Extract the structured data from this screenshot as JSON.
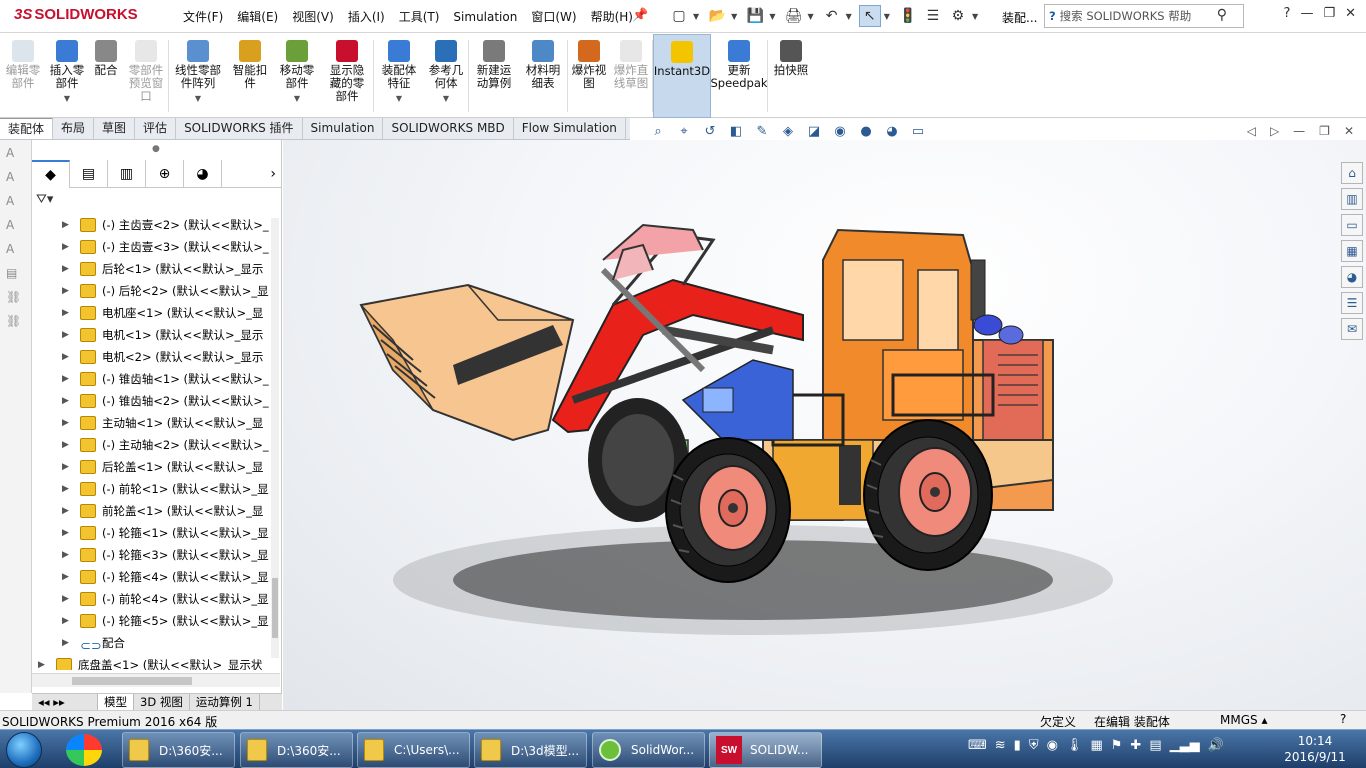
{
  "app": {
    "brand": "SOLIDWORKS",
    "menu": [
      "文件(F)",
      "编辑(E)",
      "视图(V)",
      "插入(I)",
      "工具(T)",
      "Simulation",
      "窗口(W)",
      "帮助(H)"
    ],
    "doc_label": "装配...",
    "search_placeholder": "搜索 SOLIDWORKS 帮助"
  },
  "ribbon": {
    "buttons": [
      {
        "label": "编辑零\n部件",
        "disabled": true
      },
      {
        "label": "插入零\n部件",
        "disabled": false
      },
      {
        "label": "配合",
        "disabled": false
      },
      {
        "label": "零部件\n预览窗\n口",
        "disabled": true
      },
      {
        "label": "线性零部\n件阵列",
        "disabled": false
      },
      {
        "label": "智能扣\n件",
        "disabled": false
      },
      {
        "label": "移动零\n部件",
        "disabled": false
      },
      {
        "label": "显示隐\n藏的零\n部件",
        "disabled": false
      },
      {
        "label": "装配体\n特征",
        "disabled": false
      },
      {
        "label": "参考几\n何体",
        "disabled": false
      },
      {
        "label": "新建运\n动算例",
        "disabled": false
      },
      {
        "label": "材料明\n细表",
        "disabled": false
      },
      {
        "label": "爆炸视\n图",
        "disabled": false
      },
      {
        "label": "爆炸直\n线草图",
        "disabled": true
      },
      {
        "label": "Instant3D",
        "disabled": false,
        "active": true
      },
      {
        "label": "更新\nSpeedpak",
        "disabled": false
      },
      {
        "label": "拍快照",
        "disabled": false
      }
    ]
  },
  "command_tabs": [
    "装配体",
    "布局",
    "草图",
    "评估",
    "SOLIDWORKS 插件",
    "Simulation",
    "SOLIDWORKS MBD",
    "Flow Simulation"
  ],
  "tree": {
    "items": [
      {
        "text": "(-) 主齿壹<2> (默认<<默认>_",
        "level": 1
      },
      {
        "text": "(-) 主齿壹<3> (默认<<默认>_",
        "level": 1
      },
      {
        "text": "后轮<1> (默认<<默认>_显示",
        "level": 1
      },
      {
        "text": "(-) 后轮<2> (默认<<默认>_显",
        "level": 1
      },
      {
        "text": "电机座<1> (默认<<默认>_显",
        "level": 1
      },
      {
        "text": "电机<1> (默认<<默认>_显示",
        "level": 1
      },
      {
        "text": "电机<2> (默认<<默认>_显示",
        "level": 1
      },
      {
        "text": "(-) 锥齿轴<1> (默认<<默认>_",
        "level": 1
      },
      {
        "text": "(-) 锥齿轴<2> (默认<<默认>_",
        "level": 1
      },
      {
        "text": "主动轴<1> (默认<<默认>_显",
        "level": 1
      },
      {
        "text": "(-) 主动轴<2> (默认<<默认>_",
        "level": 1
      },
      {
        "text": "后轮盖<1> (默认<<默认>_显",
        "level": 1
      },
      {
        "text": "(-) 前轮<1> (默认<<默认>_显",
        "level": 1
      },
      {
        "text": "前轮盖<1> (默认<<默认>_显",
        "level": 1
      },
      {
        "text": "(-) 轮箍<1> (默认<<默认>_显",
        "level": 1
      },
      {
        "text": "(-) 轮箍<3> (默认<<默认>_显",
        "level": 1
      },
      {
        "text": "(-) 轮箍<4> (默认<<默认>_显",
        "level": 1
      },
      {
        "text": "(-) 前轮<4> (默认<<默认>_显",
        "level": 1
      },
      {
        "text": "(-) 轮箍<5> (默认<<默认>_显",
        "level": 1
      },
      {
        "text": "配合",
        "level": 1,
        "mates": true
      },
      {
        "text": "底盘盖<1> (默认<<默认>_显示状",
        "level": 0
      }
    ]
  },
  "bottom_tabs": [
    "模型",
    "3D 视图",
    "运动算例 1"
  ],
  "status": {
    "product": "SOLIDWORKS Premium 2016 x64 版",
    "state": "欠定义",
    "mode": "在编辑 装配体",
    "units": "MMGS"
  },
  "taskbar": {
    "items": [
      "D:\\360安...",
      "D:\\360安...",
      "C:\\Users\\...",
      "D:\\3d模型...",
      "SolidWor...",
      "SOLIDW..."
    ],
    "time": "10:14",
    "date": "2016/9/11"
  },
  "colors": {
    "brand": "#c8102e",
    "accent": "#3a7bd5"
  }
}
